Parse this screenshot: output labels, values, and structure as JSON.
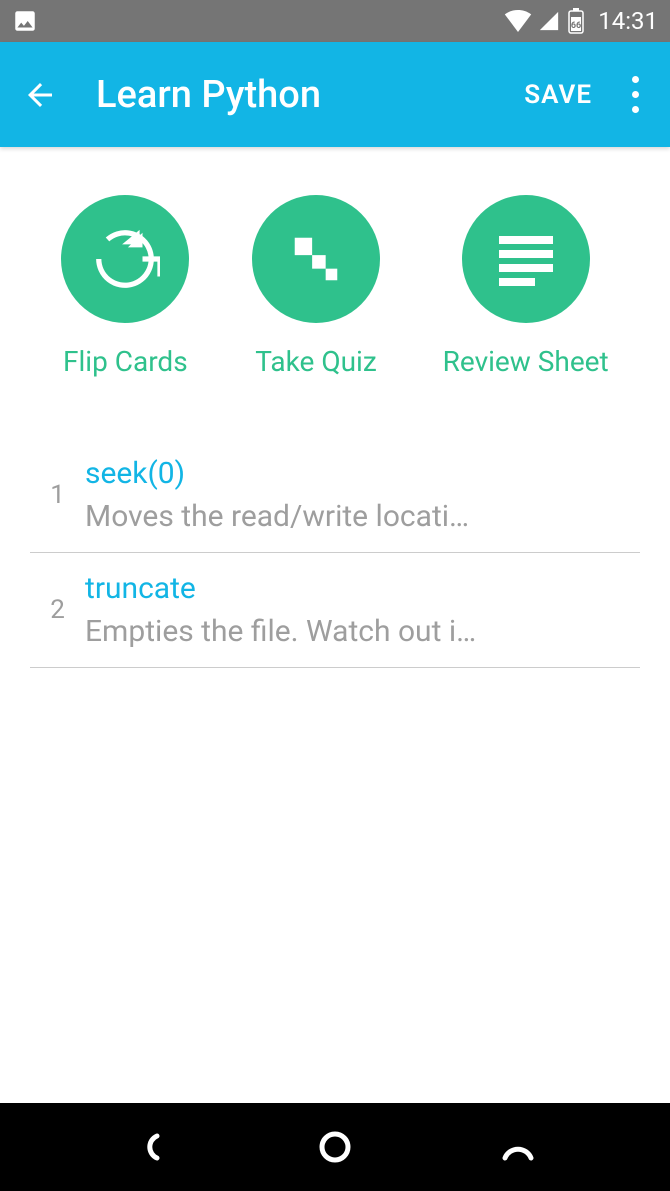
{
  "status_bar": {
    "time": "14:31",
    "battery": "66"
  },
  "app_bar": {
    "title": "Learn Python",
    "save_label": "SAVE"
  },
  "actions": {
    "flip": "Flip Cards",
    "quiz": "Take Quiz",
    "review": "Review Sheet"
  },
  "cards": [
    {
      "num": "1",
      "title": "seek(0)",
      "desc": "Moves the read/write locati…"
    },
    {
      "num": "2",
      "title": "truncate",
      "desc": "Empties the file. Watch out i…"
    }
  ]
}
